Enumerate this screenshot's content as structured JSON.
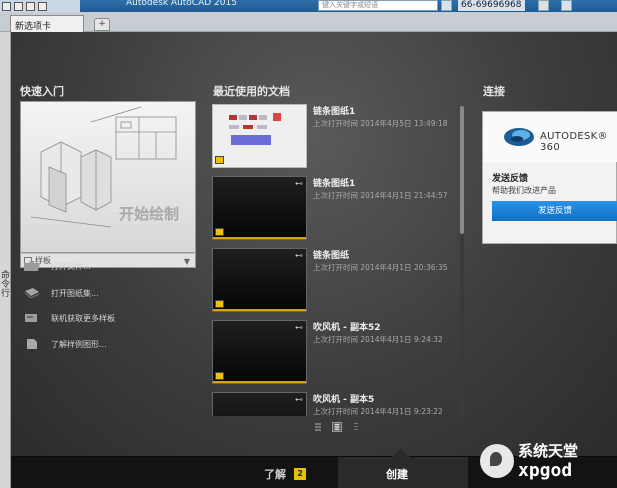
{
  "titlebar": {
    "app_title": "Autodesk AutoCAD 2015",
    "search_placeholder": "键入关键字或短语",
    "user": "66-69696968"
  },
  "tabs": {
    "active_tab": "新选项卡",
    "add_tab_icon": "+"
  },
  "left_strip": {
    "label": "命令行"
  },
  "quick_start": {
    "title": "快速入门",
    "start_drawing": "开始绘制",
    "template_label": "样板",
    "dropdown_icon": "▼",
    "links": [
      {
        "label": "打开文件...",
        "icon": "folder-icon"
      },
      {
        "label": "打开图纸集...",
        "icon": "sheet-set-icon"
      },
      {
        "label": "联机获取更多样板",
        "icon": "template-online-icon"
      },
      {
        "label": "了解样例图形...",
        "icon": "sample-drawing-icon"
      }
    ]
  },
  "recent": {
    "title": "最近使用的文档",
    "docs": [
      {
        "name": "链条图纸1",
        "date": "上次打开时间 2014年4月5日 13:49:18",
        "thumb": "light"
      },
      {
        "name": "链条图纸1",
        "date": "上次打开时间 2014年4月1日 21:44:57",
        "thumb": "dark"
      },
      {
        "name": "链条图纸",
        "date": "上次打开时间 2014年4月1日 20:36:35",
        "thumb": "dark"
      },
      {
        "name": "吹风机 - 副本52",
        "date": "上次打开时间 2014年4月1日 9:24:32",
        "thumb": "dark"
      },
      {
        "name": "吹风机 - 副本5",
        "date": "上次打开时间 2014年4月1日 9:23:22",
        "thumb": "dark"
      }
    ],
    "pin_icon": "⊷"
  },
  "connect": {
    "title": "连接",
    "logo_text": "AUTODESK® 360",
    "feedback_title": "发送反馈",
    "feedback_desc": "帮助我们改进产品",
    "feedback_button": "发送反馈"
  },
  "bottom": {
    "learn_label": "了解",
    "learn_badge": "2",
    "create_label": "创建"
  },
  "watermark": {
    "cn": "系统天堂",
    "en": "xpgod"
  },
  "colors": {
    "accent_blue": "#1a7fd6",
    "title_blue": "#2d6ea8",
    "badge_yellow": "#e3c200",
    "bg_dark": "#2b2b2b"
  }
}
